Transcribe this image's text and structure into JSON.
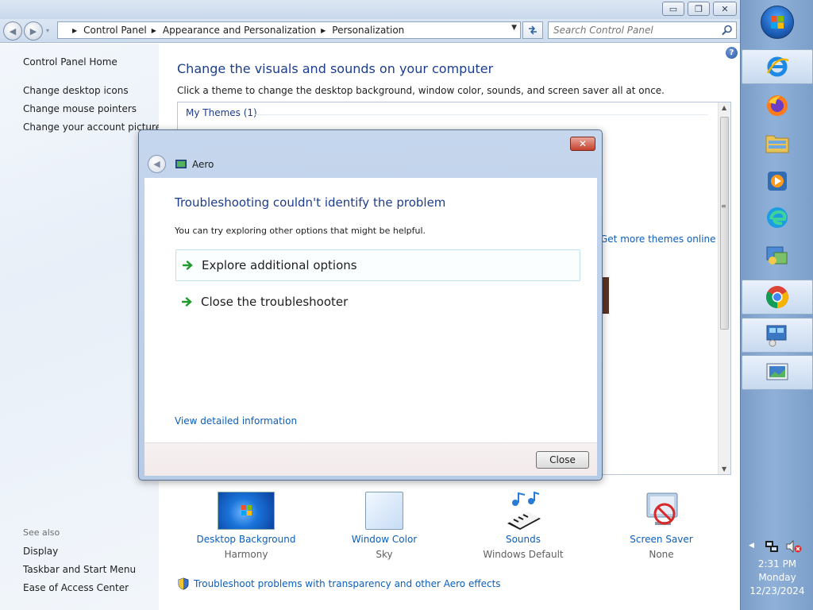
{
  "window": {
    "caption": {
      "minimize": "▭",
      "maximize": "❐",
      "close": "✕"
    }
  },
  "nav": {
    "back_glyph": "◀",
    "forward_glyph": "▶",
    "breadcrumbs": [
      "Control Panel",
      "Appearance and Personalization",
      "Personalization"
    ],
    "search_placeholder": "Search Control Panel"
  },
  "sidebar": {
    "home": "Control Panel Home",
    "links": [
      "Change desktop icons",
      "Change mouse pointers",
      "Change your account picture"
    ],
    "see_also_heading": "See also",
    "see_also": [
      "Display",
      "Taskbar and Start Menu",
      "Ease of Access Center"
    ]
  },
  "content": {
    "help": "?",
    "heading": "Change the visuals and sounds on your computer",
    "subheading": "Click a theme to change the desktop background, window color, sounds, and screen saver all at once.",
    "themes_group": "My Themes (1)",
    "more_themes_link": "Get more themes online",
    "items": [
      {
        "label": "Desktop Background",
        "value": "Harmony"
      },
      {
        "label": "Window Color",
        "value": "Sky"
      },
      {
        "label": "Sounds",
        "value": "Windows Default"
      },
      {
        "label": "Screen Saver",
        "value": "None"
      }
    ],
    "troubleshoot_link": "Troubleshoot problems with transparency and other Aero effects"
  },
  "dialog": {
    "title": "Aero",
    "close_glyph": "✕",
    "heading": "Troubleshooting couldn't identify the problem",
    "subheading": "You can try exploring other options that might be helpful.",
    "options": [
      "Explore additional options",
      "Close the troubleshooter"
    ],
    "details_link": "View detailed information",
    "close_button": "Close"
  },
  "taskbar": {
    "apps": [
      "internet-explorer",
      "firefox",
      "file-explorer",
      "media-player",
      "edge",
      "control-panel",
      "chrome",
      "remote-desktop",
      "window-app"
    ],
    "clock": {
      "time": "2:31 PM",
      "day": "Monday",
      "date": "12/23/2024"
    }
  },
  "colors": {
    "accent_link": "#0b5fbd",
    "heading": "#1d3d8b",
    "taskbar": "#8fb1d9"
  }
}
